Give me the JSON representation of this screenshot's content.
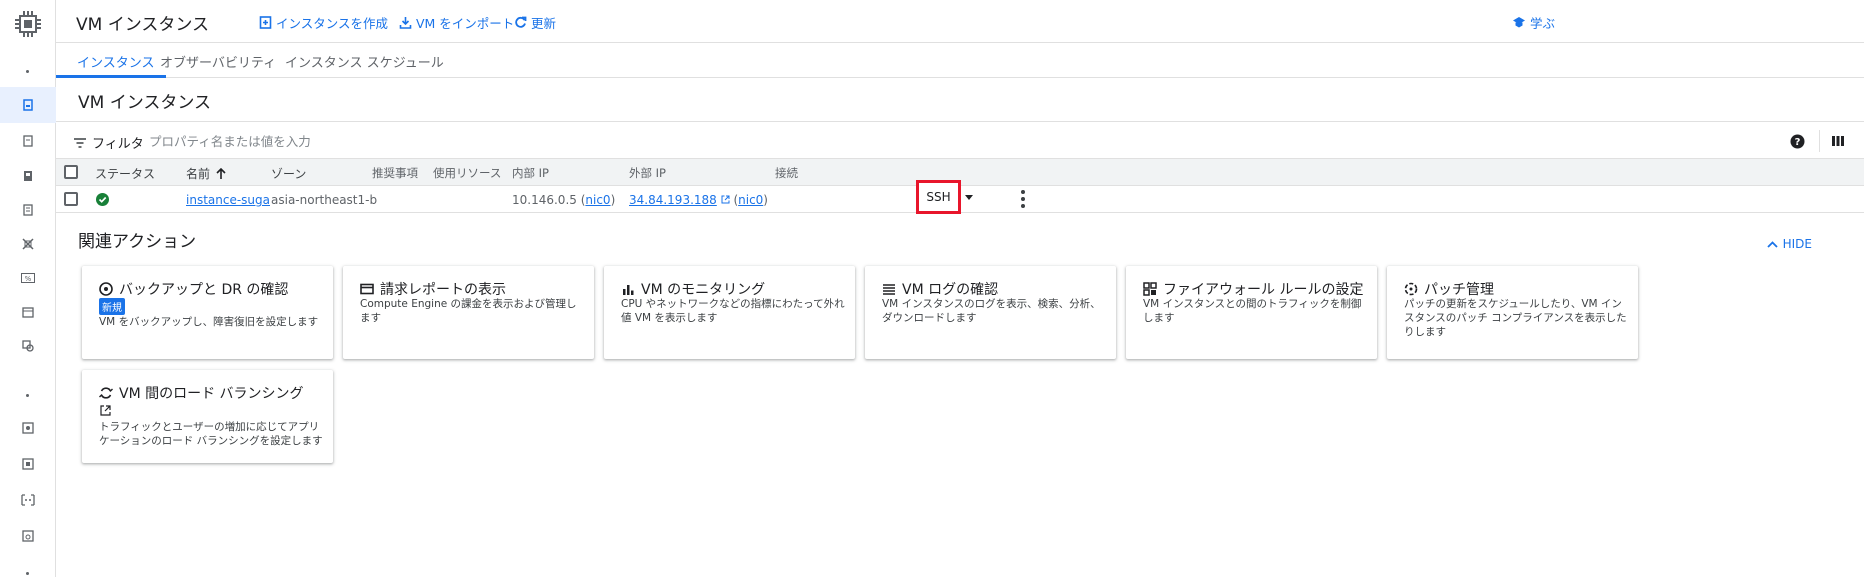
{
  "topbar": {
    "title": "VM インスタンス",
    "create_label": "インスタンスを作成",
    "import_label": "VM をインポート",
    "refresh_label": "更新",
    "learn_label": "学ぶ"
  },
  "tabs": [
    {
      "label": "インスタンス",
      "active": true
    },
    {
      "label": "オブザーバビリティ",
      "active": false
    },
    {
      "label": "インスタンス スケジュール",
      "active": false
    }
  ],
  "section_title": "VM インスタンス",
  "filter": {
    "label": "フィルタ",
    "placeholder": "プロパティ名または値を入力"
  },
  "table": {
    "headers": {
      "status": "ステータス",
      "name": "名前",
      "zone": "ゾーン",
      "recommendation": "推奨事項",
      "in_use_by": "使用リソース",
      "internal_ip": "内部 IP",
      "external_ip": "外部 IP",
      "connect": "接続"
    },
    "rows": [
      {
        "status": "running",
        "name": "instance-suga",
        "zone": "asia-northeast1-b",
        "internal_ip": "10.146.0.5",
        "internal_nic": "nic0",
        "external_ip": "34.84.193.188",
        "external_nic": "nic0",
        "connect": "SSH"
      }
    ]
  },
  "related": {
    "title": "関連アクション",
    "hide_label": "HIDE",
    "cards": [
      {
        "title": "バックアップと DR の確認",
        "badge": "新規",
        "desc": "VM をバックアップし、障害復旧を設定します",
        "icon": "backup-icon"
      },
      {
        "title": "請求レポートの表示",
        "desc": "Compute Engine の課金を表示および管理します",
        "icon": "billing-icon"
      },
      {
        "title": "VM のモニタリング",
        "desc": "CPU やネットワークなどの指標にわたって外れ値 VM を表示します",
        "icon": "monitoring-icon"
      },
      {
        "title": "VM ログの確認",
        "desc": "VM インスタンスのログを表示、検索、分析、ダウンロードします",
        "icon": "logs-icon"
      },
      {
        "title": "ファイアウォール ルールの設定",
        "desc": "VM インスタンスとの間のトラフィックを制御します",
        "icon": "firewall-icon"
      },
      {
        "title": "パッチ管理",
        "desc": "パッチの更新をスケジュールしたり、VM インスタンスのパッチ コンプライアンスを表示したりします",
        "icon": "patch-icon"
      },
      {
        "title": "VM 間のロード バランシング",
        "desc": "トラフィックとユーザーの増加に応じてアプリケーションのロード バランシングを設定します",
        "icon": "load-balancing-icon"
      }
    ]
  },
  "colors": {
    "accent": "#1a73e8",
    "highlight": "#e8152b",
    "status_ok": "#188038"
  }
}
